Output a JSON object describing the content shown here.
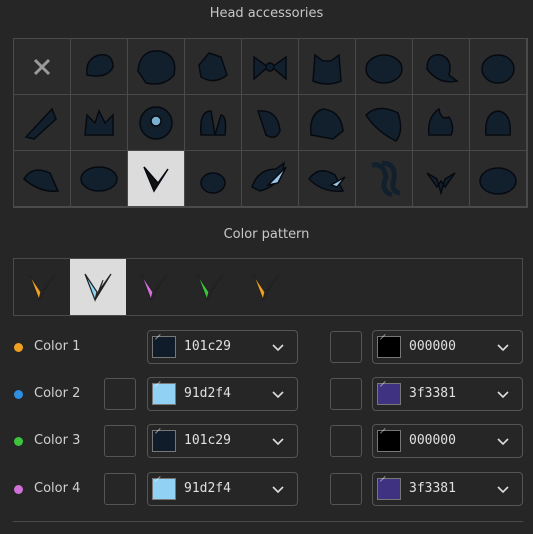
{
  "head": {
    "title": "Head accessories",
    "items": [
      "none",
      "knit-cap",
      "beret",
      "top-hat",
      "bow",
      "cat-hood",
      "round-cap",
      "balloon-hat",
      "onion-hat",
      "witch-hat",
      "crown",
      "goggles",
      "bunny-ears",
      "long-ears",
      "ponytail",
      "big-hair",
      "flame",
      "helmet",
      "bandana",
      "hair-bun",
      "feather",
      "pebble",
      "blue-plume",
      "fedora-feather",
      "curly-hair",
      "wings",
      "beanie"
    ],
    "selected_index": 20
  },
  "pattern": {
    "title": "Color pattern",
    "selected_index": 1,
    "icons": [
      "pattern-1-icon",
      "pattern-2-icon",
      "pattern-3-icon",
      "pattern-4-icon",
      "pattern-5-icon"
    ]
  },
  "colors": [
    {
      "label": "Color 1",
      "dot": "#f0a020",
      "left_hex": "101c29",
      "left_swatch": "#101c29",
      "right_hex": "000000",
      "right_swatch": "#000000"
    },
    {
      "label": "Color 2",
      "dot": "#2f8fe0",
      "left_hex": "91d2f4",
      "left_swatch": "#91d2f4",
      "right_hex": "3f3381",
      "right_swatch": "#3f3381"
    },
    {
      "label": "Color 3",
      "dot": "#3cc43c",
      "left_hex": "101c29",
      "left_swatch": "#101c29",
      "right_hex": "000000",
      "right_swatch": "#000000"
    },
    {
      "label": "Color 4",
      "dot": "#d070d8",
      "left_hex": "91d2f4",
      "left_swatch": "#91d2f4",
      "right_hex": "3f3381",
      "right_swatch": "#3f3381"
    }
  ]
}
